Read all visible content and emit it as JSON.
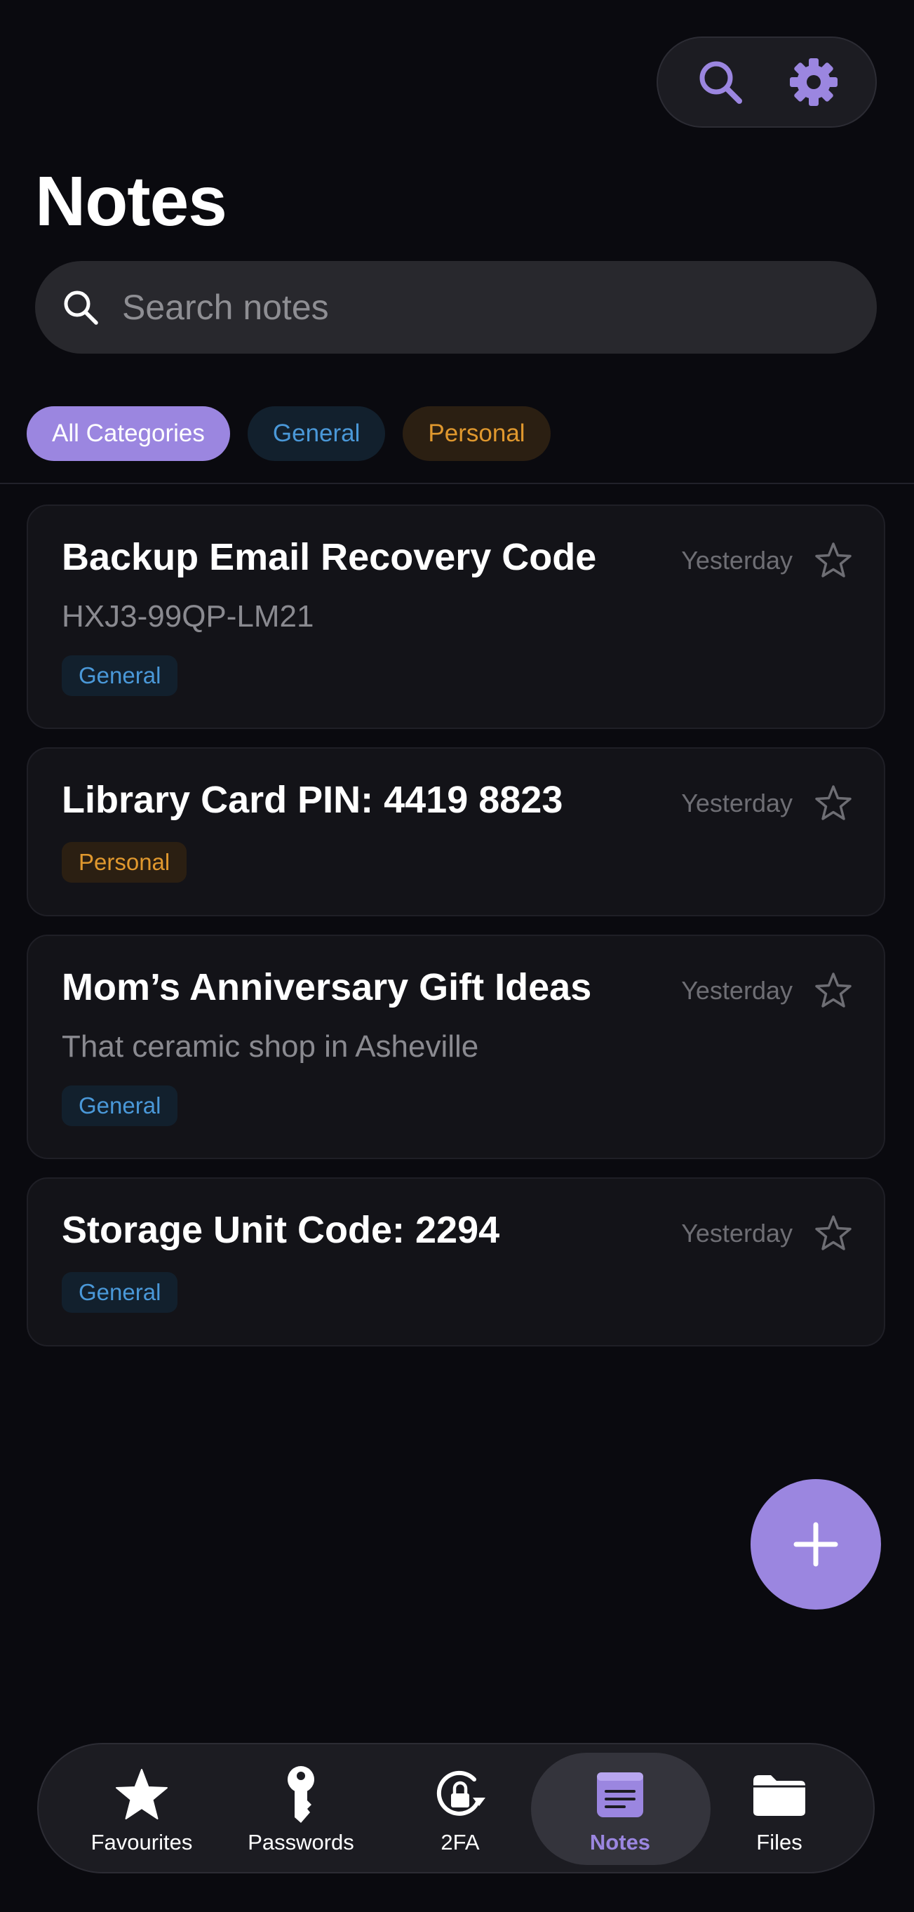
{
  "page": {
    "title": "Notes"
  },
  "header": {
    "actions": [
      "search-icon",
      "gear-icon"
    ]
  },
  "search": {
    "placeholder": "Search notes",
    "value": ""
  },
  "categories": [
    {
      "label": "All Categories",
      "active": true
    },
    {
      "label": "General",
      "active": false
    },
    {
      "label": "Personal",
      "active": false
    }
  ],
  "notes": [
    {
      "title": "Backup Email Recovery Code",
      "preview": "HXJ3-99QP-LM21",
      "tag": "General",
      "date": "Yesterday",
      "favourite": false
    },
    {
      "title": "Library Card PIN: 4419 8823",
      "preview": "",
      "tag": "Personal",
      "date": "Yesterday",
      "favourite": false
    },
    {
      "title": "Mom’s Anniversary Gift Ideas",
      "preview": "That ceramic shop in Asheville",
      "tag": "General",
      "date": "Yesterday",
      "favourite": false
    },
    {
      "title": "Storage Unit Code: 2294",
      "preview": "",
      "tag": "General",
      "date": "Yesterday",
      "favourite": false
    }
  ],
  "fab": {
    "icon": "plus-icon"
  },
  "tabbar": {
    "items": [
      {
        "label": "Favourites",
        "icon": "star-icon",
        "active": false
      },
      {
        "label": "Passwords",
        "icon": "key-icon",
        "active": false
      },
      {
        "label": "2FA",
        "icon": "lock-rotate-icon",
        "active": false
      },
      {
        "label": "Notes",
        "icon": "notes-icon",
        "active": true
      },
      {
        "label": "Files",
        "icon": "folder-icon",
        "active": false
      }
    ]
  },
  "colors": {
    "background": "#0a0a0f",
    "accent": "#9b86e0",
    "card": "#131318",
    "general": "#4a98d8",
    "personal": "#e0982e"
  }
}
